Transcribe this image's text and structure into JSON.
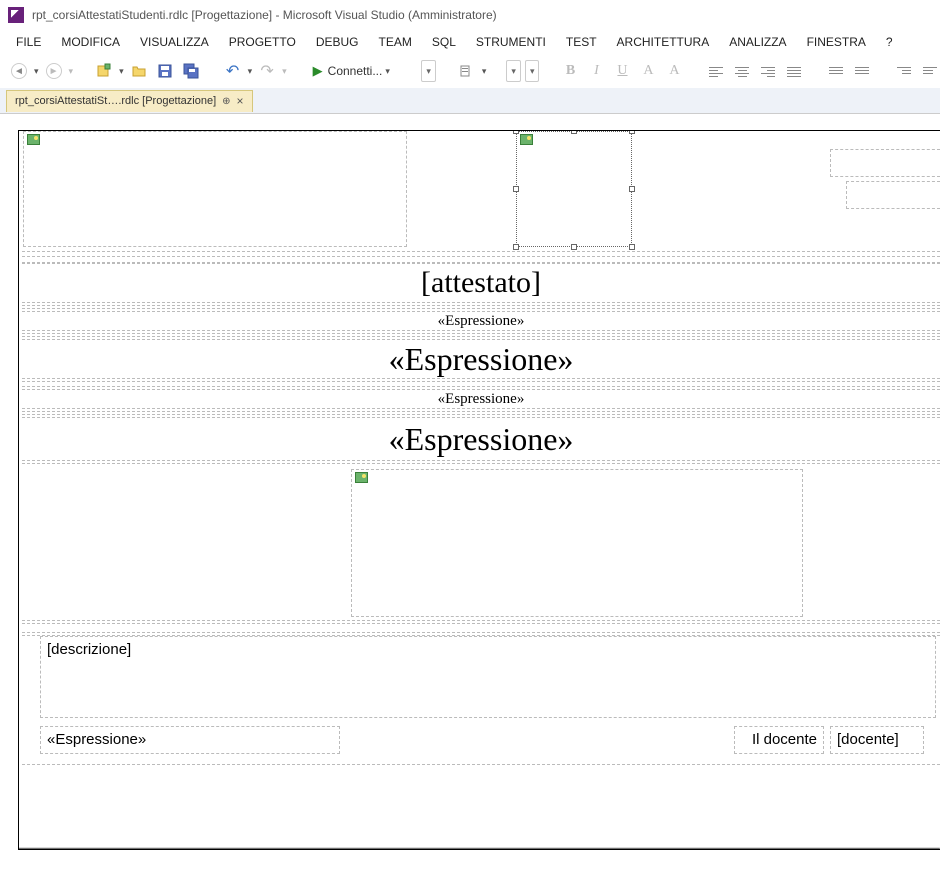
{
  "window": {
    "title": "rpt_corsiAttestatiStudenti.rdlc [Progettazione] - Microsoft Visual Studio (Amministratore)"
  },
  "menu": {
    "file": "FILE",
    "modifica": "MODIFICA",
    "visualizza": "VISUALIZZA",
    "progetto": "PROGETTO",
    "debug": "DEBUG",
    "team": "TEAM",
    "sql": "SQL",
    "strumenti": "STRUMENTI",
    "test": "TEST",
    "architettura": "ARCHITETTURA",
    "analizza": "ANALIZZA",
    "finestra": "FINESTRA",
    "help": "?"
  },
  "toolbar": {
    "connect": "Connetti...",
    "bold": "B",
    "italic": "I",
    "underline": "U",
    "fontcolor": "A",
    "bgcolor": "A"
  },
  "tab": {
    "label": "rpt_corsiAttestatiSt….rdlc [Progettazione]"
  },
  "report": {
    "attestato": "[attestato]",
    "expr_small1": "«Espressione»",
    "expr_large1": "«Espressione»",
    "expr_small2": "«Espressione»",
    "expr_large2": "«Espressione»",
    "descrizione": "[descrizione]",
    "expr_bottom": "«Espressione»",
    "il_docente": "Il docente",
    "docente": "[docente]"
  }
}
